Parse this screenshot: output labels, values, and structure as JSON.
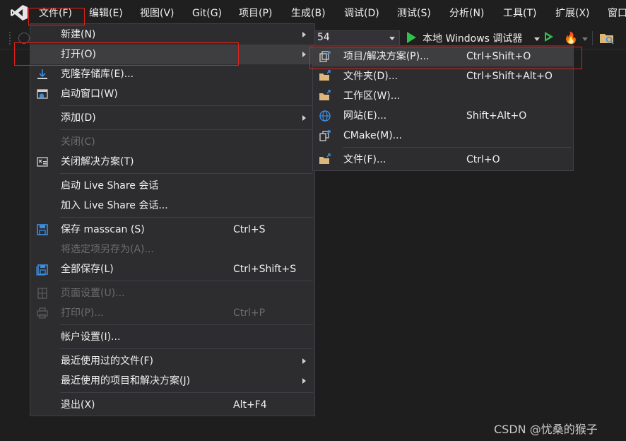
{
  "menubar": {
    "items": [
      "文件(F)",
      "编辑(E)",
      "视图(V)",
      "Git(G)",
      "项目(P)",
      "生成(B)",
      "调试(D)",
      "测试(S)",
      "分析(N)",
      "工具(T)",
      "扩展(X)",
      "窗口"
    ]
  },
  "toolbar": {
    "config_value": "54",
    "run_label": "本地 Windows 调试器"
  },
  "file_menu": {
    "items": [
      {
        "label": "新建(N)",
        "shortcut": ""
      },
      {
        "label": "打开(O)",
        "shortcut": ""
      },
      {
        "label": "克隆存储库(E)...",
        "shortcut": ""
      },
      {
        "label": "启动窗口(W)",
        "shortcut": ""
      },
      {
        "label": "添加(D)",
        "shortcut": ""
      },
      {
        "label": "关闭(C)",
        "shortcut": ""
      },
      {
        "label": "关闭解决方案(T)",
        "shortcut": ""
      },
      {
        "label": "启动 Live Share 会话",
        "shortcut": ""
      },
      {
        "label": "加入 Live Share 会话...",
        "shortcut": ""
      },
      {
        "label": "保存 masscan (S)",
        "shortcut": "Ctrl+S"
      },
      {
        "label": "将选定项另存为(A)...",
        "shortcut": ""
      },
      {
        "label": "全部保存(L)",
        "shortcut": "Ctrl+Shift+S"
      },
      {
        "label": "页面设置(U)...",
        "shortcut": ""
      },
      {
        "label": "打印(P)...",
        "shortcut": "Ctrl+P"
      },
      {
        "label": "帐户设置(I)...",
        "shortcut": ""
      },
      {
        "label": "最近使用过的文件(F)",
        "shortcut": ""
      },
      {
        "label": "最近使用的项目和解决方案(J)",
        "shortcut": ""
      },
      {
        "label": "退出(X)",
        "shortcut": "Alt+F4"
      }
    ]
  },
  "open_menu": {
    "items": [
      {
        "label": "项目/解决方案(P)...",
        "shortcut": "Ctrl+Shift+O"
      },
      {
        "label": "文件夹(D)...",
        "shortcut": "Ctrl+Shift+Alt+O"
      },
      {
        "label": "工作区(W)...",
        "shortcut": ""
      },
      {
        "label": "网站(E)...",
        "shortcut": "Shift+Alt+O"
      },
      {
        "label": "CMake(M)...",
        "shortcut": ""
      },
      {
        "label": "文件(F)...",
        "shortcut": "Ctrl+O"
      }
    ]
  },
  "watermark": "CSDN @忧桑的猴子",
  "colors": {
    "background": "#1e1e1e",
    "menu_bg": "#2d2d30",
    "highlight_box": "#e0201b",
    "run_green": "#2fc14c",
    "disabled_text": "#6d6d6d"
  }
}
